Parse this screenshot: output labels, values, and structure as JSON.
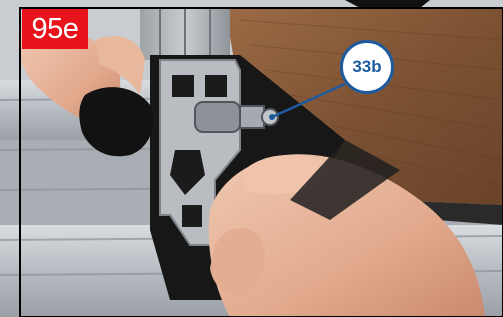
{
  "step_label": "95e",
  "callout_label": "33b",
  "colors": {
    "step_badge": "#e8131b",
    "callout_ring": "#1e5a9e",
    "leader_line": "#1e5a9e"
  },
  "icons": [
    "arrow-icon"
  ]
}
